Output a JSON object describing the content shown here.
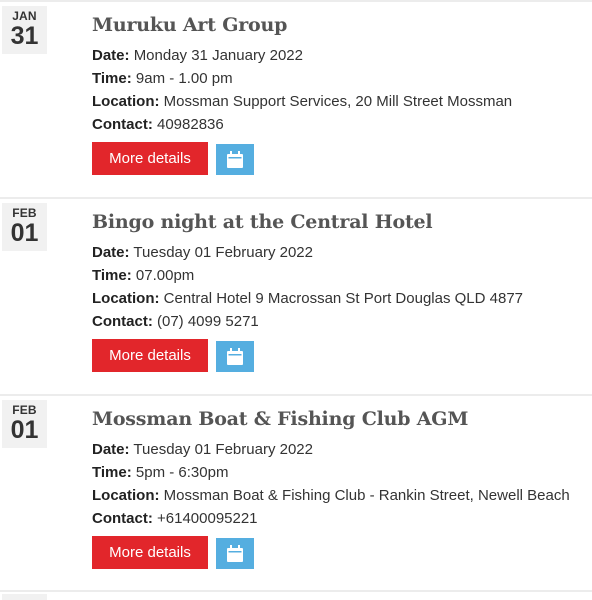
{
  "events": [
    {
      "month": "JAN",
      "day": "31",
      "title": "Muruku Art Group",
      "date_label": "Date:",
      "date": "Monday 31 January 2022",
      "time_label": "Time:",
      "time": "9am - 1.00 pm",
      "location_label": "Location:",
      "location": "Mossman Support Services, 20 Mill Street Mossman",
      "contact_label": "Contact:",
      "contact": "40982836",
      "more_label": "More details"
    },
    {
      "month": "FEB",
      "day": "01",
      "title": "Bingo night at the Central Hotel",
      "date_label": "Date:",
      "date": "Tuesday 01 February 2022",
      "time_label": "Time:",
      "time": "07.00pm",
      "location_label": "Location:",
      "location": "Central Hotel 9 Macrossan St Port Douglas QLD 4877",
      "contact_label": "Contact:",
      "contact": "(07) 4099 5271",
      "more_label": "More details"
    },
    {
      "month": "FEB",
      "day": "01",
      "title": "Mossman Boat & Fishing Club AGM",
      "date_label": "Date:",
      "date": "Tuesday 01 February 2022",
      "time_label": "Time:",
      "time": "5pm - 6:30pm",
      "location_label": "Location:",
      "location": "Mossman Boat & Fishing Club - Rankin Street, Newell Beach",
      "contact_label": "Contact:",
      "contact": "+61400095221",
      "more_label": "More details"
    }
  ],
  "colors": {
    "more_button": "#e2262b",
    "calendar_button": "#55aee0",
    "date_box": "#f1f1f1",
    "title": "#555555"
  },
  "icons": {
    "calendar_button": "calendar-icon"
  }
}
